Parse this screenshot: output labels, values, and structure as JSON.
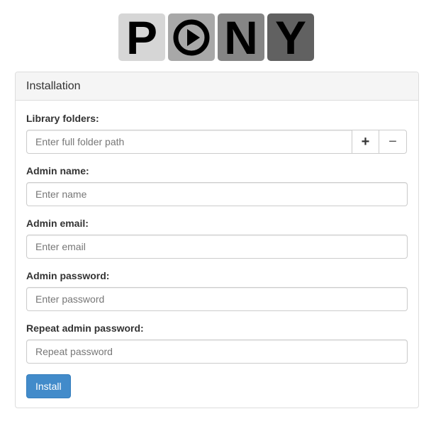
{
  "logo": {
    "letters": [
      "P",
      "O",
      "N",
      "Y"
    ],
    "play_icon": "play-circle-icon"
  },
  "panel": {
    "title": "Installation"
  },
  "form": {
    "library_folders": {
      "label": "Library folders:",
      "placeholder": "Enter full folder path",
      "add_button": "+",
      "remove_button": "−"
    },
    "admin_name": {
      "label": "Admin name:",
      "placeholder": "Enter name"
    },
    "admin_email": {
      "label": "Admin email:",
      "placeholder": "Enter email"
    },
    "admin_password": {
      "label": "Admin password:",
      "placeholder": "Enter password"
    },
    "repeat_password": {
      "label": "Repeat admin password:",
      "placeholder": "Repeat password"
    },
    "install_button": "Install"
  },
  "colors": {
    "primary": "#428bca",
    "panel_heading_bg": "#f5f5f5"
  }
}
